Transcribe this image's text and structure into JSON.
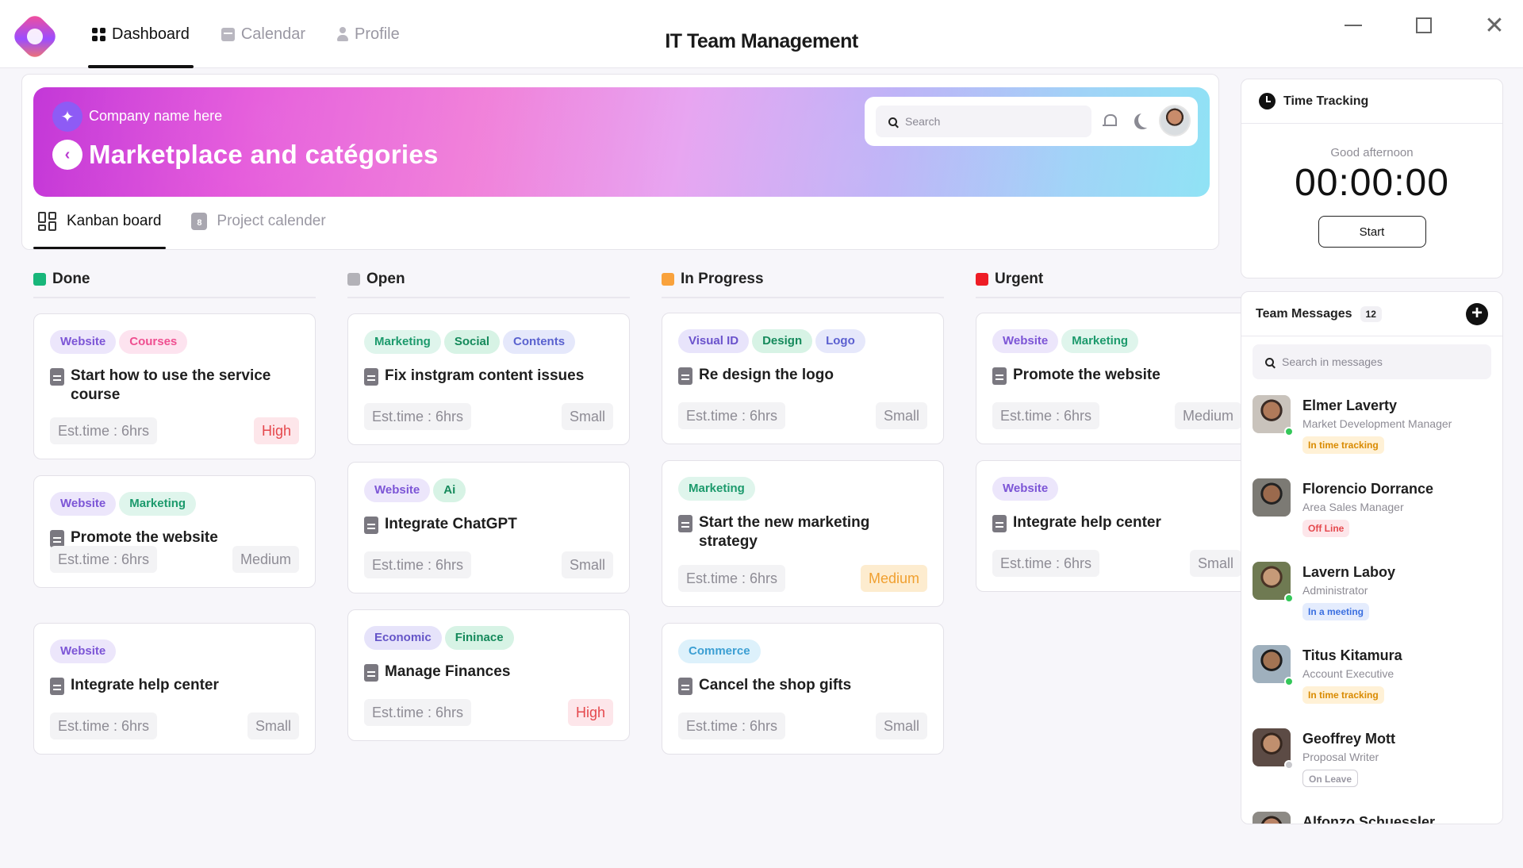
{
  "window": {
    "title": "IT Team Management"
  },
  "nav": [
    {
      "label": "Dashboard",
      "icon": "dashboard-icon",
      "active": true
    },
    {
      "label": "Calendar",
      "icon": "calendar-icon",
      "active": false
    },
    {
      "label": "Profile",
      "icon": "profile-icon",
      "active": false
    }
  ],
  "banner": {
    "company": "Company name here",
    "title": "Marketplace and catégories",
    "search_placeholder": "Search"
  },
  "tabs": [
    {
      "label": "Kanban board",
      "icon": "kanban-icon",
      "active": true
    },
    {
      "label": "Project calender",
      "icon": "project-calendar-icon",
      "active": false
    }
  ],
  "columns": [
    {
      "title": "Done",
      "color": "#18b67a",
      "cards": [
        {
          "tags": [
            "Website",
            "Courses"
          ],
          "title": "Start how to use the service course",
          "est": "Est.time : 6hrs",
          "priority": "High"
        },
        {
          "tags": [
            "Website",
            "Marketing"
          ],
          "title": "Promote the website",
          "est": "Est.time : 6hrs",
          "priority": "Medium"
        },
        {
          "tags": [
            "Website"
          ],
          "title": "Integrate help center",
          "est": "Est.time : 6hrs",
          "priority": "Small"
        }
      ]
    },
    {
      "title": "Open",
      "color": "#b3b2b8",
      "cards": [
        {
          "tags": [
            "Marketing",
            "Social",
            "Contents"
          ],
          "title": "Fix instgram content issues",
          "est": "Est.time : 6hrs",
          "priority": "Small"
        },
        {
          "tags": [
            "Website",
            "Ai"
          ],
          "title": "Integrate ChatGPT",
          "est": "Est.time : 6hrs",
          "priority": "Small"
        },
        {
          "tags": [
            "Economic",
            "Fininace"
          ],
          "title": "Manage Finances",
          "est": "Est.time : 6hrs",
          "priority": "High"
        }
      ]
    },
    {
      "title": "In Progress",
      "color": "#f9a23c",
      "cards": [
        {
          "tags": [
            "Visual ID",
            "Design",
            "Logo"
          ],
          "title": "Re design the logo",
          "est": "Est.time : 6hrs",
          "priority": "Small"
        },
        {
          "tags": [
            "Marketing"
          ],
          "title": "Start the new marketing strategy",
          "est": "Est.time : 6hrs",
          "priority": "Medium"
        },
        {
          "tags": [
            "Commerce"
          ],
          "title": "Cancel the shop gifts",
          "est": "Est.time : 6hrs",
          "priority": "Small"
        }
      ]
    },
    {
      "title": "Urgent",
      "color": "#ee1c25",
      "cards": [
        {
          "tags": [
            "Website",
            "Marketing"
          ],
          "title": "Promote the website",
          "est": "Est.time : 6hrs",
          "priority": "Medium"
        },
        {
          "tags": [
            "Website"
          ],
          "title": "Integrate help center",
          "est": "Est.time : 6hrs",
          "priority": "Small"
        }
      ]
    }
  ],
  "time_tracking": {
    "title": "Time Tracking",
    "greeting": "Good afternoon",
    "timer": "00:00:00",
    "start_label": "Start"
  },
  "team_messages": {
    "title": "Team Messages",
    "count": "12",
    "search_placeholder": "Search in messages",
    "members": [
      {
        "name": "Elmer Laverty",
        "role": "Market Development Manager",
        "status": "In time tracking",
        "presence": "#34c759"
      },
      {
        "name": "Florencio Dorrance",
        "role": "Area Sales Manager",
        "status": "Off Line",
        "presence": "none"
      },
      {
        "name": "Lavern Laboy",
        "role": "Administrator",
        "status": "In a meeting",
        "presence": "#34c759"
      },
      {
        "name": "Titus Kitamura",
        "role": "Account Executive",
        "status": "In time tracking",
        "presence": "#34c759"
      },
      {
        "name": "Geoffrey Mott",
        "role": "Proposal Writer",
        "status": "On Leave",
        "presence": "#c8c8cc"
      },
      {
        "name": "Alfonzo Schuessler",
        "role": "",
        "status": "",
        "presence": "none"
      }
    ]
  },
  "colors": {
    "tag_website": "#8a63d2",
    "tag_courses": "#ff5ea2",
    "tag_marketing": "#20a57a",
    "priority_high": "#e5484d",
    "priority_medium_accent": "#f5a623"
  }
}
